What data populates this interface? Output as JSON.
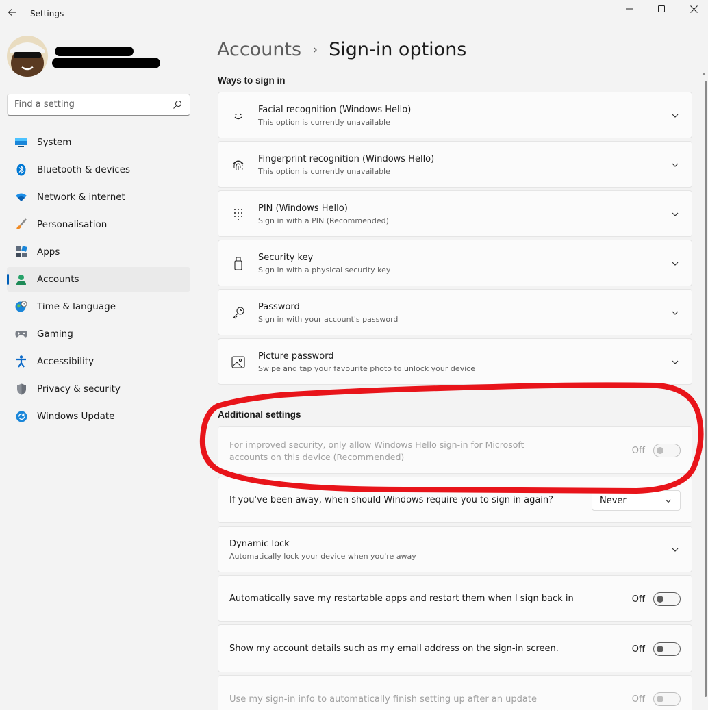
{
  "window": {
    "title": "Settings"
  },
  "search": {
    "placeholder": "Find a setting"
  },
  "nav": {
    "items": [
      {
        "label": "System",
        "icon": "system-icon"
      },
      {
        "label": "Bluetooth & devices",
        "icon": "bluetooth-icon"
      },
      {
        "label": "Network & internet",
        "icon": "wifi-icon"
      },
      {
        "label": "Personalisation",
        "icon": "brush-icon"
      },
      {
        "label": "Apps",
        "icon": "apps-icon"
      },
      {
        "label": "Accounts",
        "icon": "person-icon",
        "active": true
      },
      {
        "label": "Time & language",
        "icon": "globe-icon"
      },
      {
        "label": "Gaming",
        "icon": "gamepad-icon"
      },
      {
        "label": "Accessibility",
        "icon": "accessibility-icon"
      },
      {
        "label": "Privacy & security",
        "icon": "shield-icon"
      },
      {
        "label": "Windows Update",
        "icon": "update-icon"
      }
    ]
  },
  "breadcrumb": {
    "parent": "Accounts",
    "separator": "›",
    "current": "Sign-in options"
  },
  "ways": {
    "heading": "Ways to sign in",
    "items": [
      {
        "title": "Facial recognition (Windows Hello)",
        "subtitle": "This option is currently unavailable",
        "icon": "face-icon"
      },
      {
        "title": "Fingerprint recognition (Windows Hello)",
        "subtitle": "This option is currently unavailable",
        "icon": "fingerprint-icon"
      },
      {
        "title": "PIN (Windows Hello)",
        "subtitle": "Sign in with a PIN (Recommended)",
        "icon": "pin-keypad-icon"
      },
      {
        "title": "Security key",
        "subtitle": "Sign in with a physical security key",
        "icon": "usb-key-icon"
      },
      {
        "title": "Password",
        "subtitle": "Sign in with your account's password",
        "icon": "key-icon"
      },
      {
        "title": "Picture password",
        "subtitle": "Swipe and tap your favourite photo to unlock your device",
        "icon": "picture-icon"
      }
    ]
  },
  "additional": {
    "heading": "Additional settings",
    "hello_only": {
      "text_line1": "For improved security, only allow Windows Hello sign-in for Microsoft",
      "text_line2": "accounts on this device (Recommended)",
      "state": "Off",
      "enabled": false
    },
    "away": {
      "text": "If you've been away, when should Windows require you to sign in again?",
      "value": "Never"
    },
    "dynamic_lock": {
      "title": "Dynamic lock",
      "subtitle": "Automatically lock your device when you're away"
    },
    "restart_apps": {
      "text": "Automatically save my restartable apps and restart them when I sign back in",
      "state": "Off"
    },
    "account_details": {
      "text": "Show my account details such as my email address on the sign-in screen.",
      "state": "Off"
    },
    "signin_info": {
      "text": "Use my sign-in info to automatically finish setting up after an update",
      "state": "Off",
      "enabled": false
    }
  },
  "colors": {
    "accent": "#005fb8",
    "annotation": "#e8141a"
  }
}
